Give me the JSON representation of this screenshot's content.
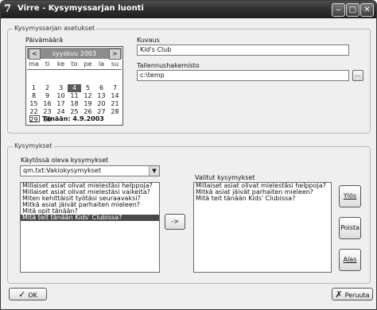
{
  "window": {
    "app_icon": "7",
    "title": "Virre - Kysymyssarjan luonti",
    "controls": {
      "minimize": "‒",
      "maximize": "□",
      "close": "✕"
    }
  },
  "settings_group": {
    "legend": "Kysymyssarjan asetukset",
    "date_label": "Päivämäärä",
    "calendar": {
      "month_label": "syyskuu 2003",
      "prev": "<",
      "next": ">",
      "weekdays": [
        "ma",
        "ti",
        "ke",
        "to",
        "pe",
        "la",
        "su"
      ],
      "days": [
        "",
        "",
        "",
        "",
        "",
        "",
        "",
        "1",
        "2",
        "3",
        "4",
        "5",
        "6",
        "7",
        "8",
        "9",
        "10",
        "11",
        "12",
        "13",
        "14",
        "15",
        "16",
        "17",
        "18",
        "19",
        "20",
        "21",
        "22",
        "23",
        "24",
        "25",
        "26",
        "27",
        "28",
        "29",
        "30",
        "",
        "",
        "",
        "",
        ""
      ],
      "today_index": 10,
      "today_label": "Tänään: 4.9.2003"
    },
    "description_label": "Kuvaus",
    "description_value": "Kid's Club",
    "save_folder_label": "Tallennushakemisto",
    "save_folder_value": "c:\\temp",
    "browse_label": "..."
  },
  "questions_group": {
    "legend": "Kysymykset",
    "in_use_label": "Käytössä oleva kysymykset",
    "in_use_value": "qm.txt:Vakiokysymykset",
    "available_questions": [
      "Millaiset asiat olivat mielestäsi helppoja?",
      "Millaiset asiat olivat mielestäsi vaikeita?",
      "Miten kehittäisit työtäsi seuraavaksi?",
      "Mitkä asiat jäivät parhaiten mieleen?",
      "Mitä opit tänään?",
      "Mitä teit tänään Kids' Clubissa?"
    ],
    "selected_available_index": 5,
    "move_button": "->",
    "chosen_label": "Valitut kysymykset",
    "chosen_questions": [
      "Millaiset asiat olivat mielestäsi helppoja?",
      "Mitkä asiat jäivät parhaiten mieleen?",
      "Mitä teit tänään Kids' Clubissa?"
    ],
    "up_button": "Ylös",
    "remove_button": "Poista",
    "down_button": "Alas"
  },
  "footer": {
    "ok_icon": "✓",
    "ok_label": "OK",
    "cancel_icon": "✗",
    "cancel_label": "Peruuta"
  }
}
